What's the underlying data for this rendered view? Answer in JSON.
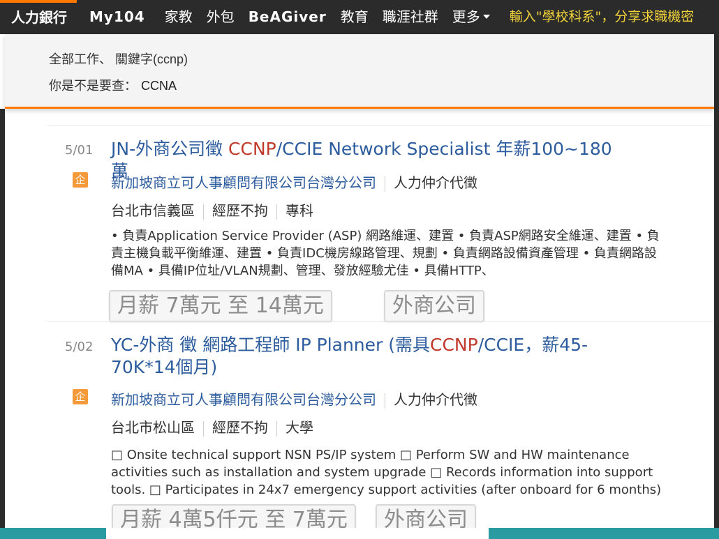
{
  "nav": {
    "items": [
      {
        "label": "人力銀行",
        "active": true
      },
      {
        "label": "My104"
      },
      {
        "label": "家教"
      },
      {
        "label": "外包"
      },
      {
        "label": "BeAGiver"
      },
      {
        "label": "教育"
      },
      {
        "label": "職涯社群"
      },
      {
        "label": "更多"
      }
    ],
    "promo": "輸入\"學校科系\"，分享求職機密"
  },
  "search": {
    "breadcrumb": "全部工作、 關鍵字(ccnp)",
    "suggest_prefix": "你是不是要查：",
    "suggest_term": "CCNA"
  },
  "jobs": [
    {
      "date": "5/01",
      "title_pre": "JN-外商公司徵 ",
      "title_hl": "CCNP",
      "title_post": "/CCIE Network Specialist 年薪100~180萬",
      "badge": "企",
      "company": "新加坡商立可人事顧問有限公司台灣分公司",
      "industry": "人力仲介代徵",
      "location": "台北市信義區",
      "experience": "經歷不拘",
      "education": "專科",
      "description": "• 負責Application Service Provider (ASP) 網路維運、建置 • 負責ASP網路安全維運、建置 • 負責主機負載平衡維運、建置 • 負責IDC機房線路管理、規劃 • 負責網路設備資產管理 • 負責網路設備MA • 具備IP位址/VLAN規劃、管理、發放經驗尤佳 • 具備HTTP、",
      "salary_tag": "月薪 7萬元 至 14萬元",
      "type_tag": "外商公司"
    },
    {
      "date": "5/02",
      "title_pre": "YC-外商 徵 網路工程師 IP Planner (需具",
      "title_hl": "CCNP",
      "title_post": "/CCIE，薪45-70K*14個月)",
      "badge": "企",
      "company": "新加坡商立可人事顧問有限公司台灣分公司",
      "industry": "人力仲介代徵",
      "location": "台北市松山區",
      "experience": "經歷不拘",
      "education": "大學",
      "description": "□ Onsite technical support NSN PS/IP system □ Perform SW and HW maintenance activities such as installation and system upgrade □ Records information into support tools. □ Participates in 24x7 emergency support activities (after onboard for 6 months)",
      "salary_tag": "月薪 4萬5仟元 至 7萬元",
      "type_tag": "外商公司"
    }
  ]
}
